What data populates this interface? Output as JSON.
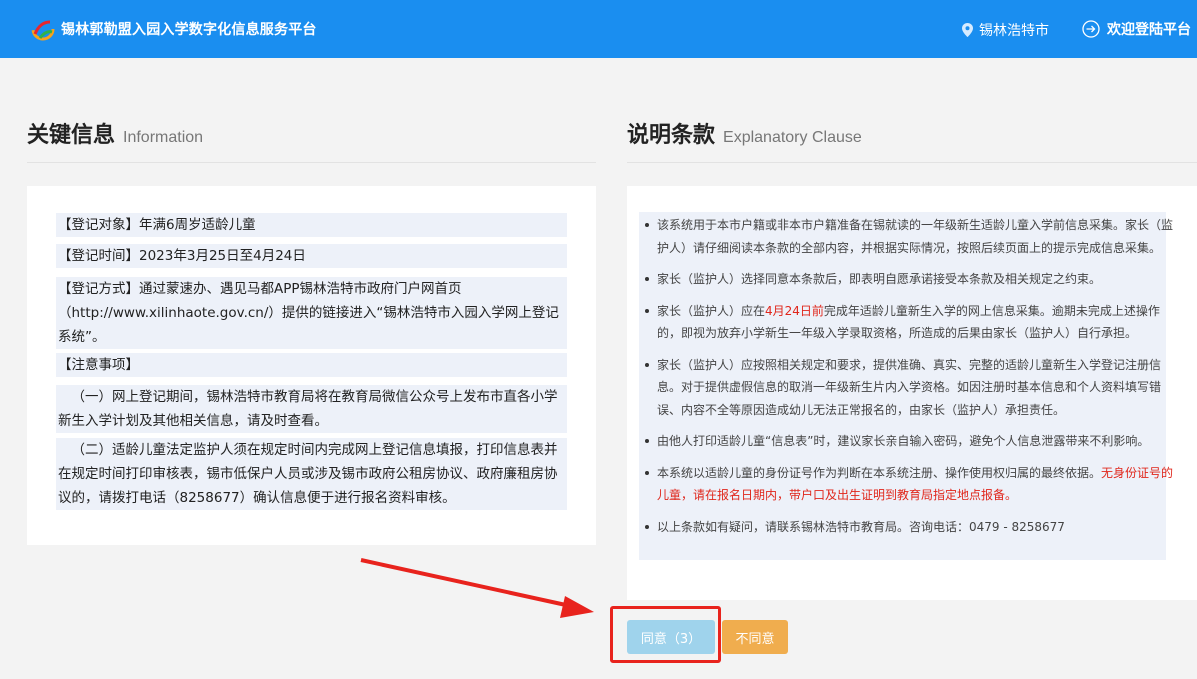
{
  "header": {
    "title": "锡林郭勒盟入园入学数字化信息服务平台",
    "location": "锡林浩特市",
    "login": "欢迎登陆平台"
  },
  "key_info": {
    "title_cn": "关键信息",
    "title_en": "Information",
    "items": [
      "【登记对象】年满6周岁适龄儿童",
      "【登记时间】2023年3月25日至4月24日",
      "【登记方式】通过蒙速办、遇见马都APP锡林浩特市政府门户网首页（http://www.xilinhaote.gov.cn/）提供的链接进入“锡林浩特市入园入学网上登记系统”。",
      "【注意事项】",
      "（一）网上登记期间，锡林浩特市教育局将在教育局微信公众号上发布市直各小学新生入学计划及其他相关信息，请及时查看。",
      "（二）适龄儿童法定监护人须在规定时间内完成网上登记信息填报，打印信息表并在规定时间打印审核表，锡市低保户人员或涉及锡市政府公租房协议、政府廉租房协议的，请拨打电话（8258677）确认信息便于进行报名资料审核。"
    ]
  },
  "clause": {
    "title_cn": "说明条款",
    "title_en": "Explanatory Clause",
    "items": [
      {
        "text": "该系统用于本市户籍或非本市户籍准备在锡就读的一年级新生适龄儿童入学前信息采集。家长（监护人）请仔细阅读本条款的全部内容，并根据实际情况，按照后续页面上的提示完成信息采集。"
      },
      {
        "text": "家长（监护人）选择同意本条款后，即表明自愿承诺接受本条款及相关规定之约束。"
      },
      {
        "pre": "家长（监护人）应在",
        "red": "4月24日前",
        "post": "完成年适龄儿童新生入学的网上信息采集。逾期未完成上述操作的，即视为放弃小学新生一年级入学录取资格，所造成的后果由家长（监护人）自行承担。"
      },
      {
        "text": "家长（监护人）应按照相关规定和要求，提供准确、真实、完整的适龄儿童新生入学登记注册信息。对于提供虚假信息的取消一年级新生片内入学资格。如因注册时基本信息和个人资料填写错误、内容不全等原因造成幼儿无法正常报名的，由家长（监护人）承担责任。"
      },
      {
        "text": "由他人打印适龄儿童“信息表”时，建议家长亲自输入密码，避免个人信息泄露带来不利影响。"
      },
      {
        "pre": "本系统以适龄儿童的身份证号作为判断在本系统注册、操作使用权归属的最终依据。",
        "red": "无身份证号的儿童，请在报名日期内，带户口及出生证明到教育局指定地点报备。",
        "post": ""
      },
      {
        "text": "以上条款如有疑问，请联系锡林浩特市教育局。咨询电话：0479 - 8258677"
      }
    ]
  },
  "buttons": {
    "agree": "同意（3）",
    "disagree": "不同意"
  },
  "colors": {
    "header": "#1a8ef0",
    "highlight": "#e8231d",
    "agree": "#9fd3ec",
    "disagree": "#f0ad4e"
  }
}
